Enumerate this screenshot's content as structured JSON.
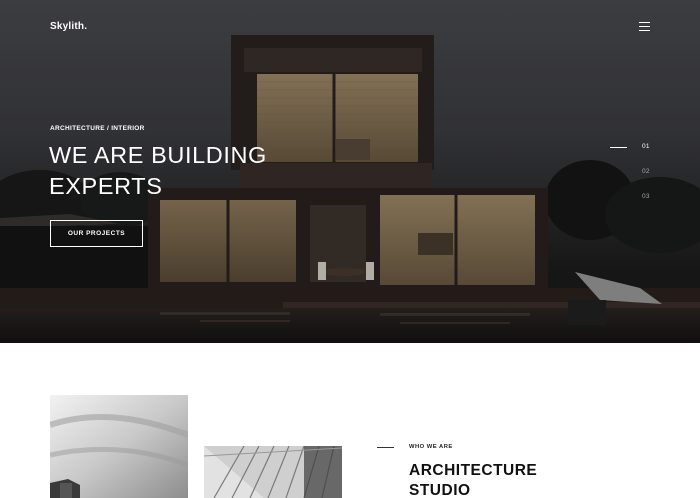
{
  "header": {
    "logo": "Skylith.",
    "menu_icon": "hamburger-menu-icon"
  },
  "hero": {
    "eyebrow": "ARCHITECTURE / INTERIOR",
    "headline_line1": "WE ARE BUILDING",
    "headline_line2": "EXPERTS",
    "cta_label": "OUR PROJECTS",
    "slides": [
      "01",
      "02",
      "03"
    ],
    "active_slide": "01"
  },
  "about": {
    "eyebrow": "WHO WE ARE",
    "title_line1": "ARCHITECTURE",
    "title_line2": "STUDIO"
  },
  "colors": {
    "hero_overlay": "#2c2c2f",
    "text_light": "#ffffff",
    "text_muted": "#a6a6a6",
    "text_dark": "#111111"
  }
}
